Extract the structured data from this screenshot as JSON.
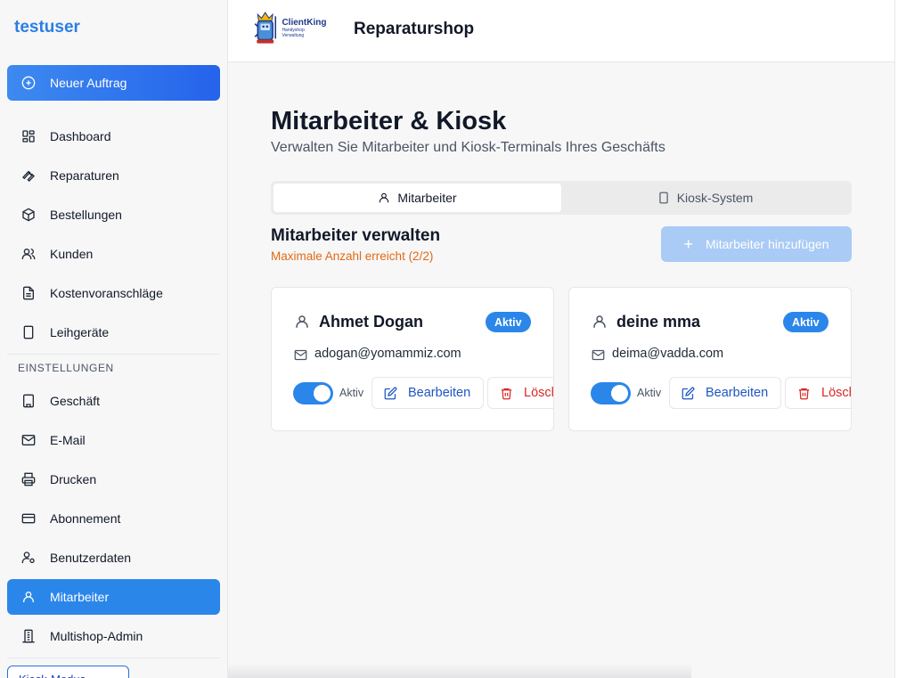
{
  "sidebar": {
    "user": "testuser",
    "new_order": "Neuer Auftrag",
    "items": [
      {
        "label": "Dashboard",
        "icon": "dashboard-icon"
      },
      {
        "label": "Reparaturen",
        "icon": "wrench-icon"
      },
      {
        "label": "Bestellungen",
        "icon": "package-icon"
      },
      {
        "label": "Kunden",
        "icon": "users-icon"
      },
      {
        "label": "Kostenvoranschläge",
        "icon": "document-icon"
      },
      {
        "label": "Leihgeräte",
        "icon": "tablet-icon"
      }
    ],
    "settings_label": "EINSTELLUNGEN",
    "settings_items": [
      {
        "label": "Geschäft",
        "icon": "building-icon"
      },
      {
        "label": "E-Mail",
        "icon": "mail-icon"
      },
      {
        "label": "Drucken",
        "icon": "printer-icon"
      },
      {
        "label": "Abonnement",
        "icon": "credit-card-icon"
      },
      {
        "label": "Benutzerdaten",
        "icon": "user-cog-icon"
      },
      {
        "label": "Mitarbeiter",
        "icon": "user-icon",
        "active": true
      },
      {
        "label": "Multishop-Admin",
        "icon": "buildings-icon"
      }
    ],
    "kiosk_button": "Kiosk-Modus"
  },
  "header": {
    "logo_name": "ClientKing",
    "logo_sub": "Handyshop Verwaltung",
    "shop_title": "Reparaturshop"
  },
  "main": {
    "title": "Mitarbeiter & Kiosk",
    "subtitle": "Verwalten Sie Mitarbeiter und Kiosk-Terminals Ihres Geschäfts",
    "tabs": [
      {
        "label": "Mitarbeiter",
        "active": true
      },
      {
        "label": "Kiosk-System",
        "active": false
      }
    ],
    "section_title": "Mitarbeiter verwalten",
    "section_warning": "Maximale Anzahl erreicht (2/2)",
    "add_button": "Mitarbeiter hinzufügen",
    "employees": [
      {
        "name": "Ahmet Dogan",
        "status": "Aktiv",
        "email": "adogan@yomammiz.com",
        "toggle_label": "Aktiv",
        "toggle_on": true,
        "edit": "Bearbeiten",
        "delete": "Löschen"
      },
      {
        "name": "deine mma",
        "status": "Aktiv",
        "email": "deima@vadda.com",
        "toggle_label": "Aktiv",
        "toggle_on": true,
        "edit": "Bearbeiten",
        "delete": "Löschen"
      }
    ]
  },
  "colors": {
    "accent": "#2b86ea",
    "warning": "#e26a12",
    "danger": "#dc2626",
    "edit": "#1e56c4"
  }
}
